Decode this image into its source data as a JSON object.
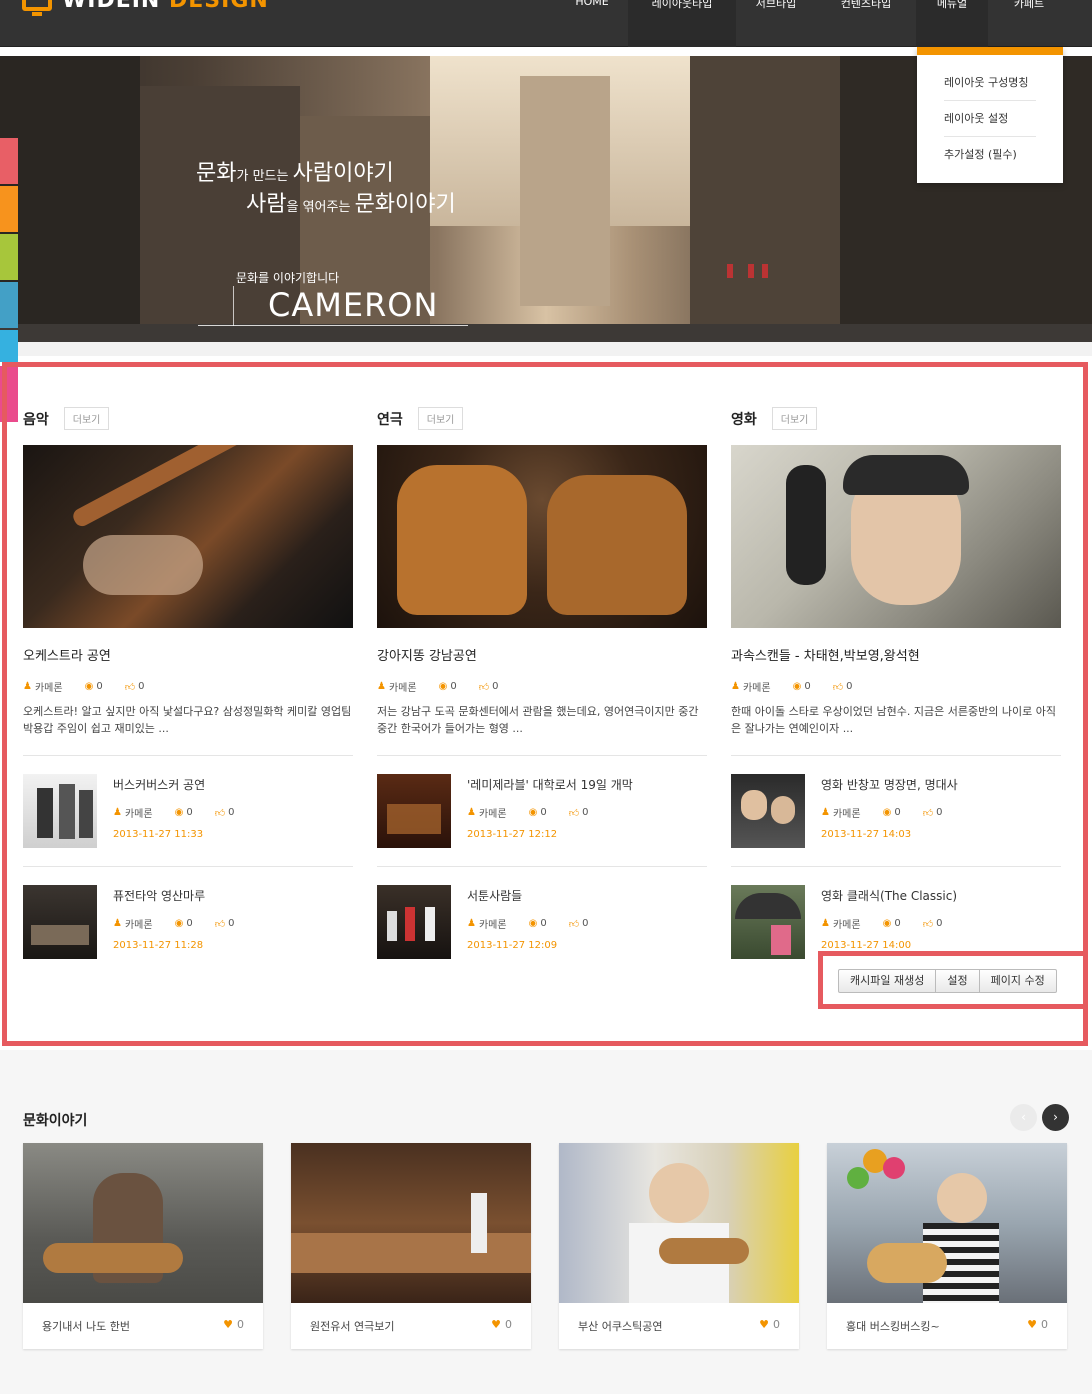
{
  "header": {
    "logo_text_1": "WIDEIN",
    "logo_text_2": "DESIGN",
    "nav": [
      "HOME",
      "레이아웃타입",
      "서브타입",
      "컨텐츠타입",
      "메뉴얼",
      "카페트"
    ]
  },
  "dropdown": [
    "레이아웃 구성명칭",
    "레이아웃 설정",
    "추가설정 (필수)"
  ],
  "hero": {
    "line1_a": "문화",
    "line1_b": "가 만드는 ",
    "line1_c": "사람이야기",
    "line2_a": "사람",
    "line2_b": "을 엮어주는 ",
    "line2_c": "문화이야기",
    "sub": "문화를 이야기합니다",
    "brand": "CAMERON"
  },
  "colors": {
    "accent": "#f39400",
    "frame": "#e65a5f",
    "tabs": [
      "#e85f66",
      "#f7931d",
      "#a7c63b",
      "#43a0c6",
      "#35b1e0",
      "#ea4b8c"
    ]
  },
  "columns": [
    {
      "title": "음악",
      "more": "더보기",
      "main_title": "오케스트라 공연",
      "author": "카메론",
      "comments": "0",
      "likes": "0",
      "desc": "오케스트라! 알고 싶지만 아직 낯설다구요? 삼성정밀화학 케미칼 영업팀 박용갑 주임이 쉽고 재미있는 ...",
      "items": [
        {
          "title": "버스커버스커 공연",
          "author": "카메론",
          "comments": "0",
          "likes": "0",
          "date": "2013-11-27 11:33"
        },
        {
          "title": "퓨전타악 영산마루",
          "author": "카메론",
          "comments": "0",
          "likes": "0",
          "date": "2013-11-27 11:28"
        }
      ]
    },
    {
      "title": "연극",
      "more": "더보기",
      "main_title": "강아지똥 강남공연",
      "author": "카메론",
      "comments": "0",
      "likes": "0",
      "desc": "저는 강남구 도곡 문화센터에서 관람을 했는데요, 영어연극이지만 중간중간 한국어가 들어가는 형영 ...",
      "items": [
        {
          "title": "'레미제라블' 대학로서 19일 개막",
          "author": "카메론",
          "comments": "0",
          "likes": "0",
          "date": "2013-11-27 12:12"
        },
        {
          "title": "서툰사람들",
          "author": "카메론",
          "comments": "0",
          "likes": "0",
          "date": "2013-11-27 12:09"
        }
      ]
    },
    {
      "title": "영화",
      "more": "더보기",
      "main_title": "과속스캔들 - 차태현,박보영,왕석현",
      "author": "카메론",
      "comments": "0",
      "likes": "0",
      "desc": "한때 아이돌 스타로 우상이었던 남현수. 지금은 서른중반의 나이로 아직은 잘나가는 연예인이자 ...",
      "items": [
        {
          "title": "영화 반창꼬 명장면, 명대사",
          "author": "카메론",
          "comments": "0",
          "likes": "0",
          "date": "2013-11-27 14:03"
        },
        {
          "title": "영화 클래식(The Classic)",
          "author": "카메론",
          "comments": "0",
          "likes": "0",
          "date": "2013-11-27 14:00"
        }
      ]
    }
  ],
  "admin_buttons": [
    "캐시파일 재생성",
    "설정",
    "페이지 수정"
  ],
  "bottom": {
    "title": "문화이야기",
    "prev": "‹",
    "next": "›",
    "cards": [
      {
        "label": "용기내서 나도 한번",
        "likes": "0"
      },
      {
        "label": "원전유서 연극보기",
        "likes": "0"
      },
      {
        "label": "부산 어쿠스틱공연",
        "likes": "0"
      },
      {
        "label": "홍대 버스킹버스킹~",
        "likes": "0"
      }
    ]
  }
}
